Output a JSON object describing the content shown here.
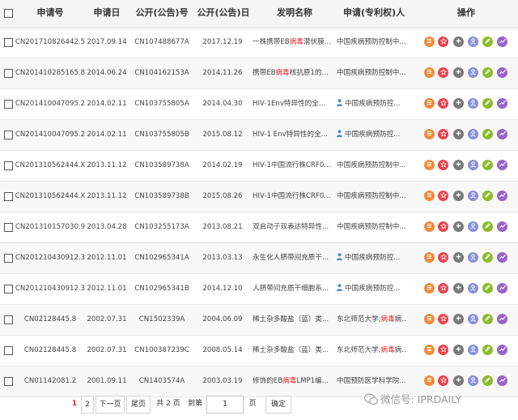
{
  "columns": {
    "app_no": "申请号",
    "app_date": "申请日",
    "pub_no": "公开(公告)号",
    "pub_date": "公开(公告)日",
    "title": "发明名称",
    "applicant": "申请(专利权)人",
    "ops": "操作"
  },
  "rows": [
    {
      "app_no": "CN201710826442.5",
      "app_date": "2017.09.14",
      "pub_no": "CN107488677A",
      "pub_date": "2017.12.19",
      "title_a": "一株携带EB",
      "title_hl": "病毒",
      "title_b": "潜伏膜...",
      "applicant_a": "中国疾病预防控制中...",
      "applicant_hl": "",
      "applicant_b": "",
      "person": false
    },
    {
      "app_no": "CN201410285165.8",
      "app_date": "2014.06.24",
      "pub_no": "CN104162153A",
      "pub_date": "2014.11.26",
      "title_a": "携带EB",
      "title_hl": "病毒",
      "title_b": "核抗原1的...",
      "applicant_a": "中国疾病预防控制中...",
      "applicant_hl": "",
      "applicant_b": "",
      "person": false
    },
    {
      "app_no": "CN201410047095.2",
      "app_date": "2014.02.11",
      "pub_no": "CN103755805A",
      "pub_date": "2014.04.30",
      "title_a": "HIV-1Env特异性的全...",
      "title_hl": "",
      "title_b": "",
      "applicant_a": "中国疾病预防控...",
      "applicant_hl": "",
      "applicant_b": "",
      "person": true
    },
    {
      "app_no": "CN201410047095.2",
      "app_date": "2014.02.11",
      "pub_no": "CN103755805B",
      "pub_date": "2015.08.12",
      "title_a": "HIV-1 Env特异性的全...",
      "title_hl": "",
      "title_b": "",
      "applicant_a": "中国疾病预防控...",
      "applicant_hl": "",
      "applicant_b": "",
      "person": true
    },
    {
      "app_no": "CN201310562444.X",
      "app_date": "2013.11.12",
      "pub_no": "CN103589738A",
      "pub_date": "2014.02.19",
      "title_a": "HIV-1中国流行株CRF0...",
      "title_hl": "",
      "title_b": "",
      "applicant_a": "中国疾病预防控制中...",
      "applicant_hl": "",
      "applicant_b": "",
      "person": false
    },
    {
      "app_no": "CN201310562444.X",
      "app_date": "2013.11.12",
      "pub_no": "CN103589738B",
      "pub_date": "2015.08.26",
      "title_a": "HIV-1中国流行株CRF0...",
      "title_hl": "",
      "title_b": "",
      "applicant_a": "中国疾病预防控制中...",
      "applicant_hl": "",
      "applicant_b": "",
      "person": false
    },
    {
      "app_no": "CN201310157030.9",
      "app_date": "2013.04.28",
      "pub_no": "CN103255173A",
      "pub_date": "2013.08.21",
      "title_a": "双启动子双表达特异性...",
      "title_hl": "",
      "title_b": "",
      "applicant_a": "中国疾病预防控制中...",
      "applicant_hl": "",
      "applicant_b": "",
      "person": false
    },
    {
      "app_no": "CN201210430912.3",
      "app_date": "2012.11.01",
      "pub_no": "CN102965341A",
      "pub_date": "2013.03.13",
      "title_a": "永生化人脐带间充质干...",
      "title_hl": "",
      "title_b": "",
      "applicant_a": "中国疾病预防控...",
      "applicant_hl": "",
      "applicant_b": "",
      "person": true
    },
    {
      "app_no": "CN201210430912.3",
      "app_date": "2012.11.01",
      "pub_no": "CN102965341B",
      "pub_date": "2014.12.10",
      "title_a": "人脐带间充质干细胞系...",
      "title_hl": "",
      "title_b": "",
      "applicant_a": "中国疾病预防控...",
      "applicant_hl": "",
      "applicant_b": "",
      "person": true
    },
    {
      "app_no": "CN02128445.8",
      "app_date": "2002.07.31",
      "pub_no": "CN1502339A",
      "pub_date": "2004.06.09",
      "title_a": "稀土杂多酸盐（蓝）类...",
      "title_hl": "",
      "title_b": "",
      "applicant_a": "东北师范大学;",
      "applicant_hl": "病毒",
      "applicant_b": "病...",
      "person": false
    },
    {
      "app_no": "CN02128445.8",
      "app_date": "2002.07.31",
      "pub_no": "CN100387239C",
      "pub_date": "2008.05.14",
      "title_a": "稀土杂多酸盐（蓝）类...",
      "title_hl": "",
      "title_b": "",
      "applicant_a": "东北师范大学;",
      "applicant_hl": "病毒",
      "applicant_b": "病...",
      "person": false
    },
    {
      "app_no": "CN01142081.2",
      "app_date": "2001.09.11",
      "pub_no": "CN1403574A",
      "pub_date": "2003.03.19",
      "title_a": "修饰的EB",
      "title_hl": "病毒",
      "title_b": "LMP1编...",
      "applicant_a": "中国预防医学科学院...",
      "applicant_hl": "",
      "applicant_b": "",
      "person": false
    }
  ],
  "action_icons": [
    {
      "name": "list-icon",
      "color": "#f08c3c"
    },
    {
      "name": "star-icon",
      "color": "#e8424d"
    },
    {
      "name": "plus-icon",
      "color": "#7a7a7a"
    },
    {
      "name": "user-icon",
      "color": "#8a8fd8"
    },
    {
      "name": "pencil-icon",
      "color": "#8dbb2c"
    },
    {
      "name": "trend-icon",
      "color": "#9a63c8"
    }
  ],
  "pagination": {
    "page1": "1",
    "page2": "2",
    "next": "下一页",
    "last": "尾页",
    "total": "共 2 页",
    "goto": "到第",
    "input_value": "1",
    "page_unit": "页",
    "confirm": "确定"
  },
  "watermark": "微信号: IPRDAILY",
  "colors": {
    "highlight": "#e0262c",
    "header_bg": "#f5f5f5",
    "person_icon": "#4a90d9"
  }
}
